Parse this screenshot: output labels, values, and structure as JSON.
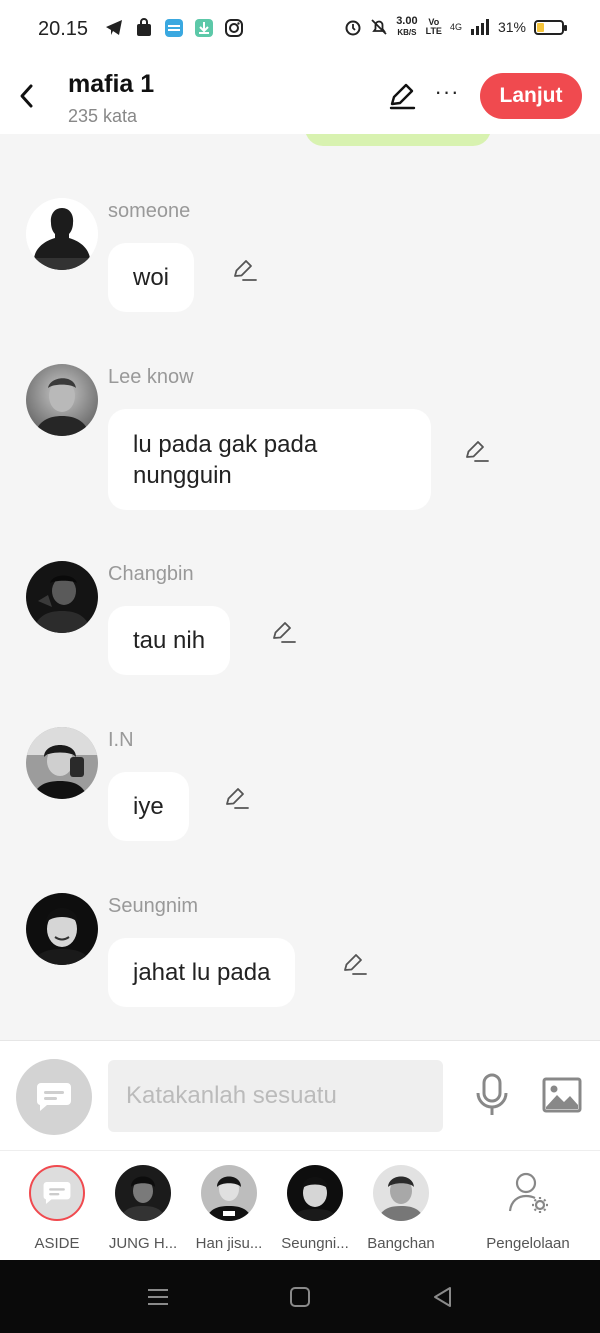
{
  "status_bar": {
    "time": "20.15",
    "speed_top": "3.00",
    "speed_unit": "KB/S",
    "net": "4G",
    "battery_pct": "31%",
    "battery_level": 0.31
  },
  "header": {
    "title": "mafia 1",
    "subtitle": "235 kata",
    "continue_label": "Lanjut"
  },
  "messages": [
    {
      "name": "someone",
      "text": "woi"
    },
    {
      "name": "Lee know",
      "text": "lu pada gak pada nungguin"
    },
    {
      "name": "Changbin",
      "text": "tau nih"
    },
    {
      "name": "I.N",
      "text": "iye"
    },
    {
      "name": "Seungnim",
      "text": "jahat lu pada"
    }
  ],
  "input": {
    "placeholder": "Katakanlah sesuatu"
  },
  "characters": [
    {
      "label": "ASIDE"
    },
    {
      "label": "JUNG H..."
    },
    {
      "label": "Han jisu..."
    },
    {
      "label": "Seungni..."
    },
    {
      "label": "Bangchan"
    },
    {
      "label": "Pengelolaan"
    }
  ],
  "colors": {
    "accent": "#f04a4f",
    "bubble_bg": "#ffffff",
    "chat_bg": "#f5f5f5"
  }
}
